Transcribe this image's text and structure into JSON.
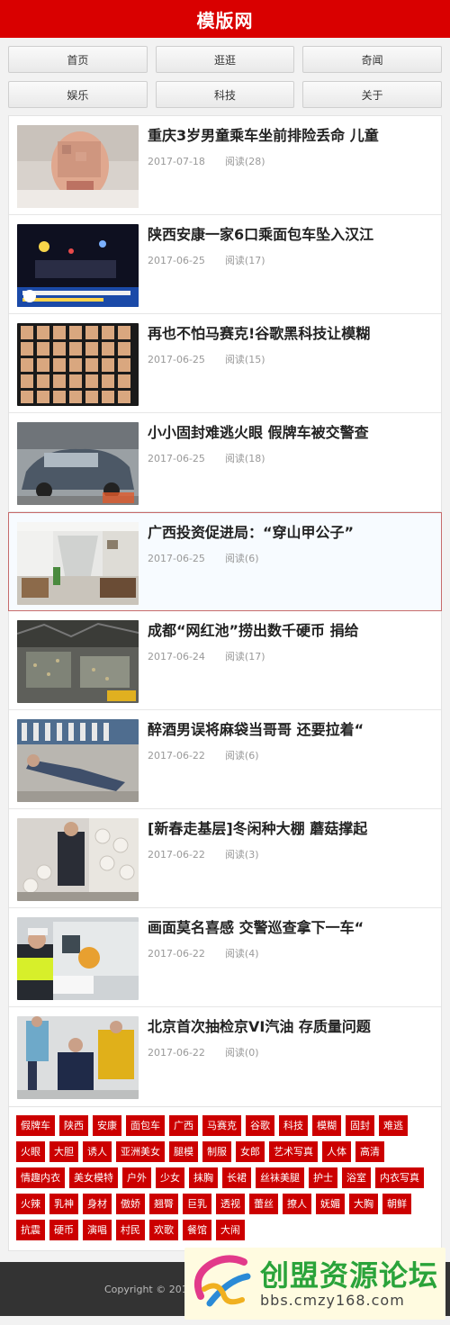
{
  "header": {
    "title": "模版网"
  },
  "nav": [
    {
      "label": "首页"
    },
    {
      "label": "逛逛"
    },
    {
      "label": "奇闻"
    },
    {
      "label": "娱乐"
    },
    {
      "label": "科技"
    },
    {
      "label": "关于"
    }
  ],
  "articles": [
    {
      "title": "重庆3岁男童乘车坐前排险丢命 儿童",
      "date": "2017-07-18",
      "views": "阅读(28)",
      "image": "blurred-child-face-photo"
    },
    {
      "title": "陕西安康一家6口乘面包车坠入汉江",
      "date": "2017-06-25",
      "views": "阅读(17)",
      "image": "night-rescue-news-photo"
    },
    {
      "title": "再也不怕马赛克!谷歌黑科技让模糊",
      "date": "2017-06-25",
      "views": "阅读(15)",
      "image": "face-grid-photo"
    },
    {
      "title": "小小固封难逃火眼 假牌车被交警查",
      "date": "2017-06-25",
      "views": "阅读(18)",
      "image": "car-photo"
    },
    {
      "title": "广西投资促进局：“穿山甲公子”",
      "date": "2017-06-25",
      "views": "阅读(6)",
      "image": "corridor-photo"
    },
    {
      "title": "成都“网红池”捞出数千硬币 捐给",
      "date": "2017-06-24",
      "views": "阅读(17)",
      "image": "coins-pool-photo"
    },
    {
      "title": "醉酒男误将麻袋当哥哥 还要拉着“",
      "date": "2017-06-22",
      "views": "阅读(6)",
      "image": "drunk-man-photo"
    },
    {
      "title": "[新春走基层]冬闲种大棚 蘑菇撑起",
      "date": "2017-06-22",
      "views": "阅读(3)",
      "image": "mushroom-farm-photo"
    },
    {
      "title": "画面莫名喜感 交警巡查拿下一车“",
      "date": "2017-06-22",
      "views": "阅读(4)",
      "image": "traffic-police-photo"
    },
    {
      "title": "北京首次抽检京VI汽油 存质量问题",
      "date": "2017-06-22",
      "views": "阅读(0)",
      "image": "gasoline-inspection-photo"
    }
  ],
  "tags": [
    "假牌车",
    "陕西",
    "安康",
    "面包车",
    "广西",
    "马赛克",
    "谷歌",
    "科技",
    "模糊",
    "固封",
    "难逃",
    "火眼",
    "大胆",
    "诱人",
    "亚洲美女",
    "腿模",
    "制服",
    "女郎",
    "艺术写真",
    "人体",
    "高清",
    "情趣内衣",
    "美女模特",
    "户外",
    "少女",
    "抹胸",
    "长裙",
    "丝袜美腿",
    "护士",
    "浴室",
    "内衣写真",
    "火辣",
    "乳神",
    "身材",
    "傲娇",
    "翘臀",
    "巨乳",
    "透视",
    "蕾丝",
    "撩人",
    "妩媚",
    "大胸",
    "朝鲜",
    "抗震",
    "硬币",
    "演唱",
    "村民",
    "欢歌",
    "餐馆",
    "大闹"
  ],
  "footer": {
    "copyright": "Copyright © 2014"
  },
  "watermark": {
    "name": "创盟资源论坛",
    "url": "bbs.cmzy168.com"
  },
  "colors": {
    "brand": "#d90000",
    "tag": "#cc0000",
    "watermark_text": "#2aa33a"
  }
}
